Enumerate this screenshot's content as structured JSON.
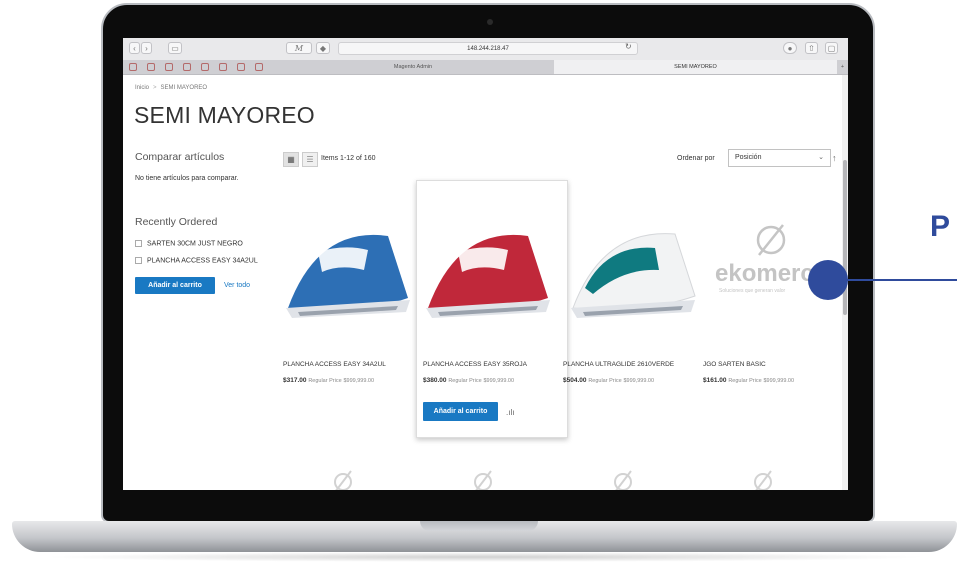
{
  "browser": {
    "url": "148.244.218.47",
    "tabs": [
      {
        "label": "Magento Admin",
        "active": false
      },
      {
        "label": "SEMI MAYOREO",
        "active": true
      }
    ],
    "reader_glyph": "M"
  },
  "breadcrumb": {
    "home": "Inicio",
    "separator": ">",
    "current": "SEMI MAYOREO"
  },
  "page_title": "SEMI MAYOREO",
  "sidebar": {
    "compare_title": "Comparar artículos",
    "compare_empty": "No tiene artículos para comparar.",
    "recent_title": "Recently Ordered",
    "recent_items": [
      "SARTEN 30CM JUST NEGRO",
      "PLANCHA ACCESS EASY 34A2UL"
    ],
    "add_to_cart": "Añadir al carrito",
    "view_all": "Ver todo"
  },
  "toolbar": {
    "items_count": "Items 1-12 of 160",
    "sort_label": "Ordenar por",
    "sort_value": "Posición",
    "sort_direction_icon": "arrow-up"
  },
  "products": [
    {
      "name": "PLANCHA ACCESS EASY 34A2UL",
      "price": "$317.00",
      "regular_label": "Regular Price",
      "regular_price": "$999,999.00",
      "color": "#2d6fb5"
    },
    {
      "name": "PLANCHA ACCESS EASY 35ROJA",
      "price": "$380.00",
      "regular_label": "Regular Price",
      "regular_price": "$999,999.00",
      "color": "#c0283a"
    },
    {
      "name": "PLANCHA ULTRAGLIDE 2610VERDE",
      "price": "$504.00",
      "regular_label": "Regular Price",
      "regular_price": "$999,999.00",
      "color": "#0f7a80"
    },
    {
      "name": "JGO SARTEN BASIC",
      "price": "$161.00",
      "regular_label": "Regular Price",
      "regular_price": "$999,999.00",
      "color": "#cccccc"
    }
  ],
  "hover_card": {
    "add_to_cart": "Añadir al carrito"
  },
  "placeholder": {
    "brand": "ekomerc",
    "tagline": "Soluciones que generan valor"
  },
  "overlay": {
    "letter": "P"
  },
  "colors": {
    "accent": "#1979c3",
    "overlay": "#2f4b9c"
  }
}
